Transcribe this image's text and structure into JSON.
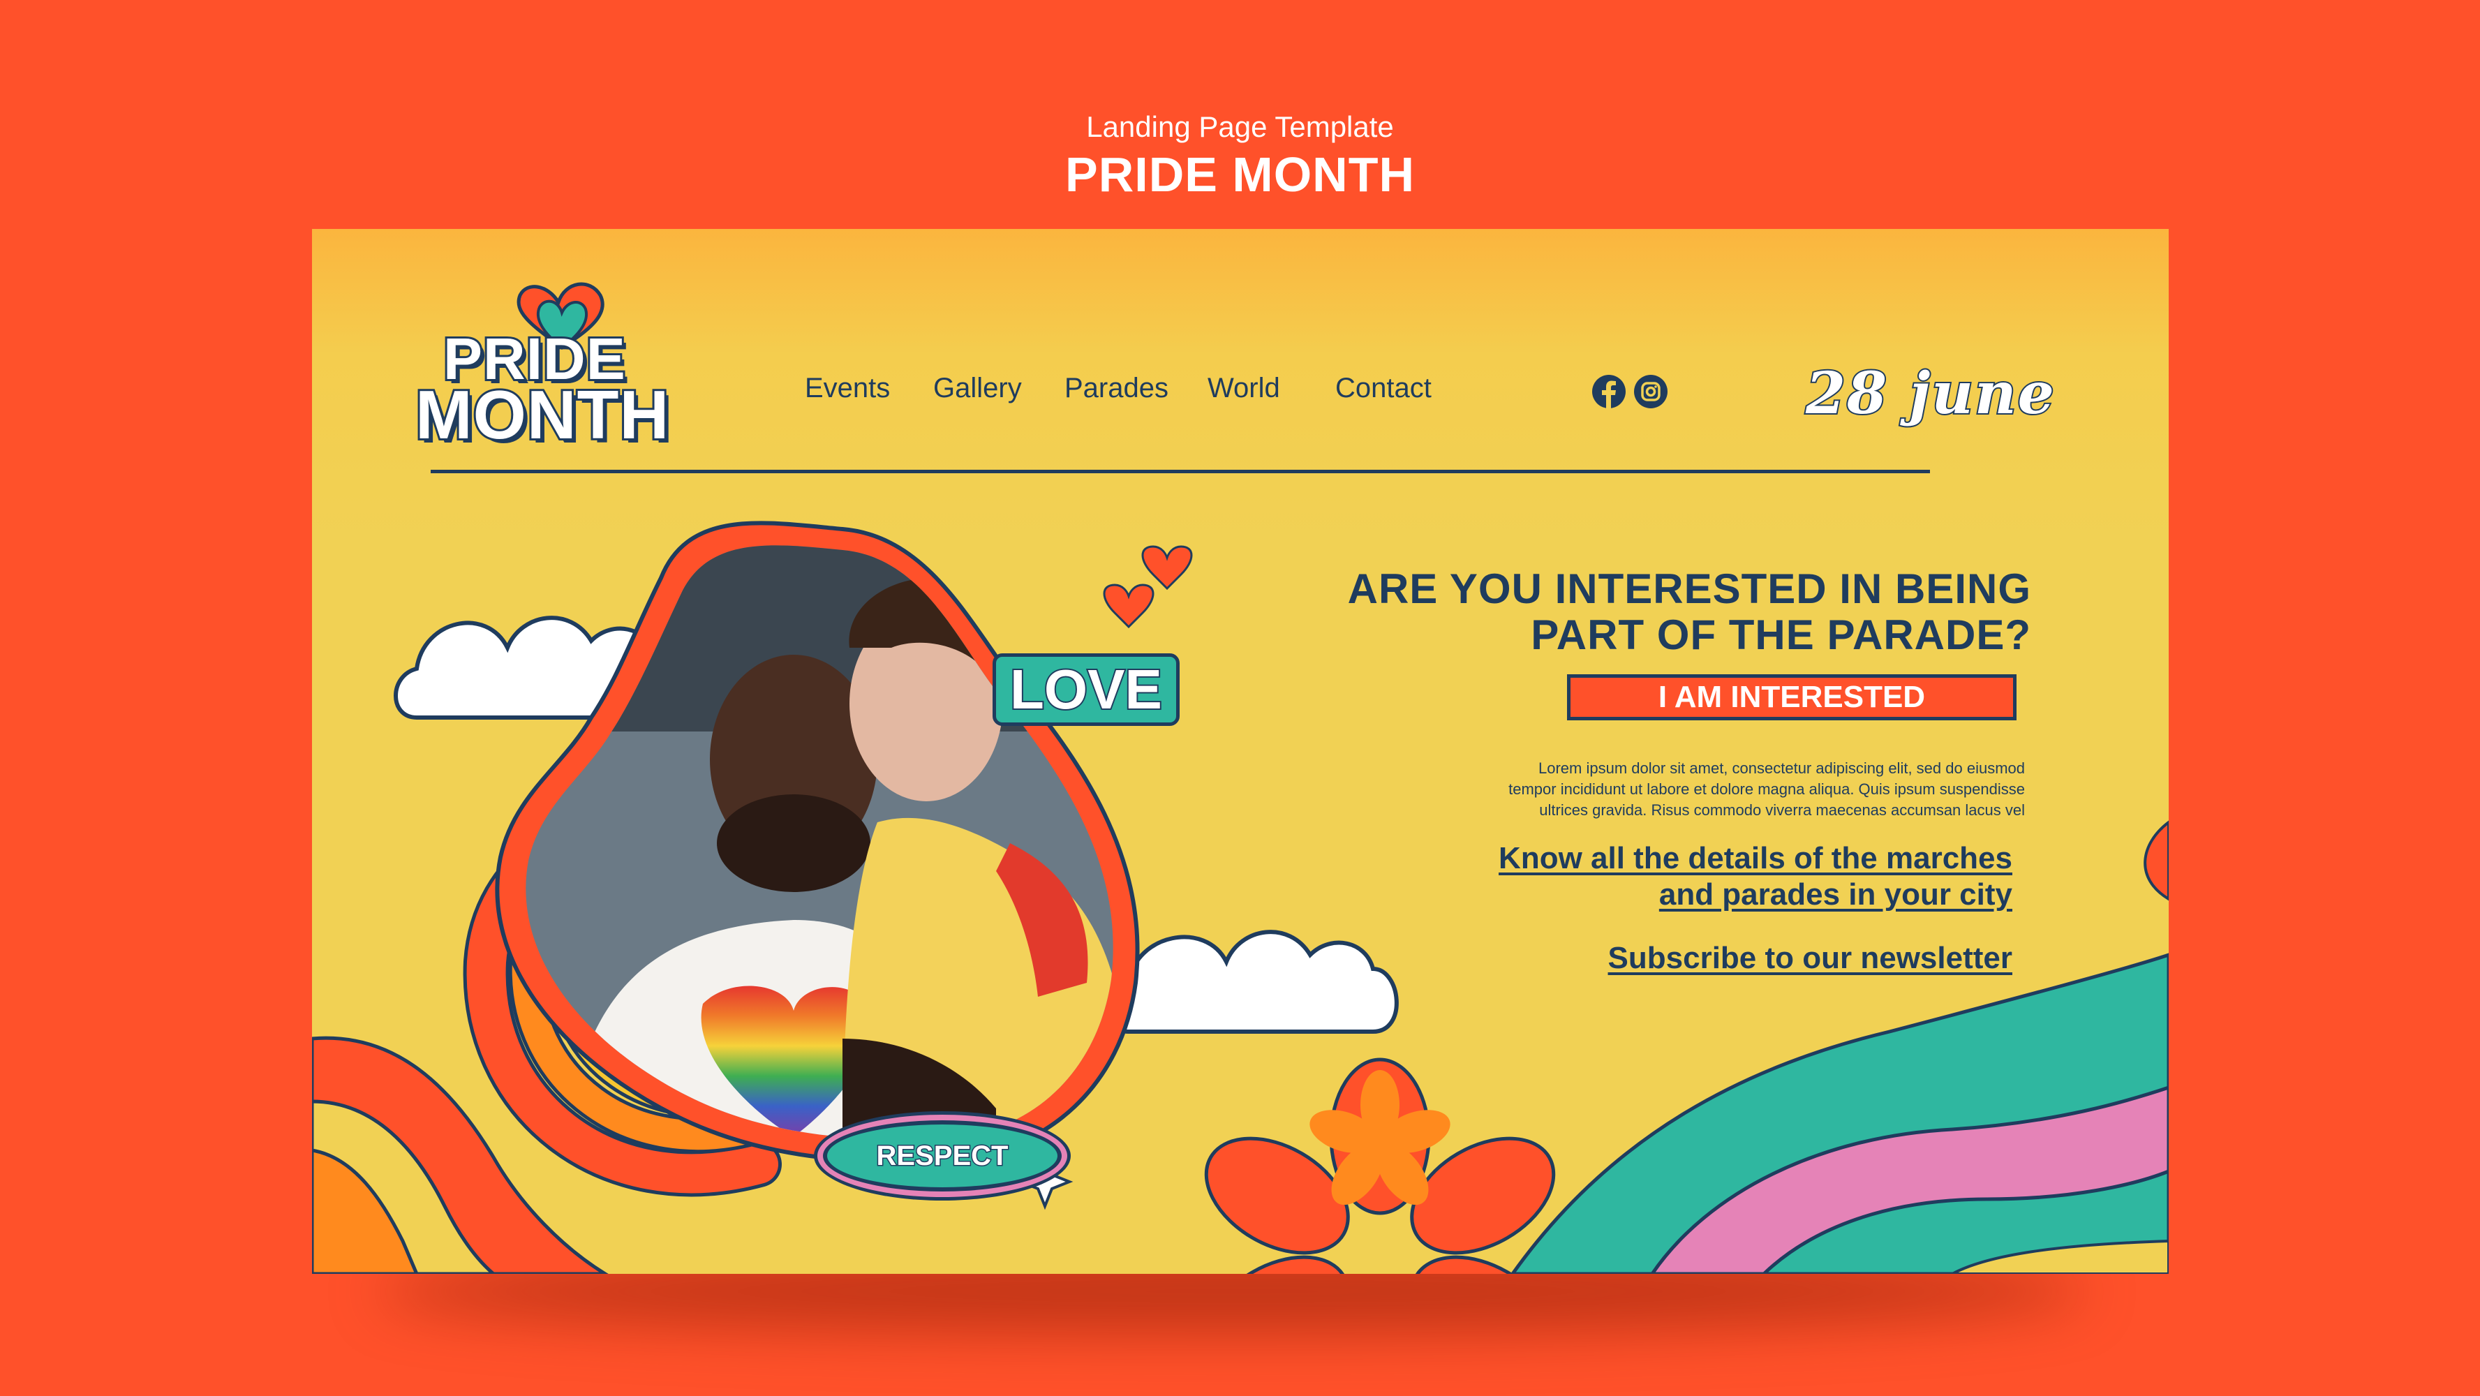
{
  "template": {
    "caption": "Landing Page Template",
    "title": "PRIDE MONTH"
  },
  "header": {
    "logo_line1": "PRIDE",
    "logo_line2": "MONTH",
    "nav": [
      "Events",
      "Gallery",
      "Parades",
      "World",
      "Contact"
    ],
    "social_icons": [
      "facebook-icon",
      "instagram-icon"
    ],
    "date": "28 june"
  },
  "hero": {
    "headline_line1": "ARE YOU INTERESTED IN BEING",
    "headline_line2": "PART OF THE PARADE?",
    "cta_label": "I AM INTERESTED",
    "body_line1": "Lorem ipsum dolor sit amet, consectetur adipiscing elit, sed do eiusmod",
    "body_line2": "tempor incididunt ut labore et dolore magna aliqua. Quis ipsum suspendisse",
    "body_line3": "ultrices gravida. Risus commodo viverra maecenas accumsan lacus vel",
    "link1_line1": "Know all the details of the marches",
    "link1_line2": "and parades in your city",
    "link2": "Subscribe to our newsletter"
  },
  "stickers": {
    "love": "LOVE",
    "respect": "RESPECT"
  },
  "colors": {
    "background": "#ff512a",
    "card": "#f1d154",
    "navy": "#1f3c5e",
    "teal": "#2fb7a0",
    "pink": "#e583b7",
    "orange": "#ff512a"
  }
}
